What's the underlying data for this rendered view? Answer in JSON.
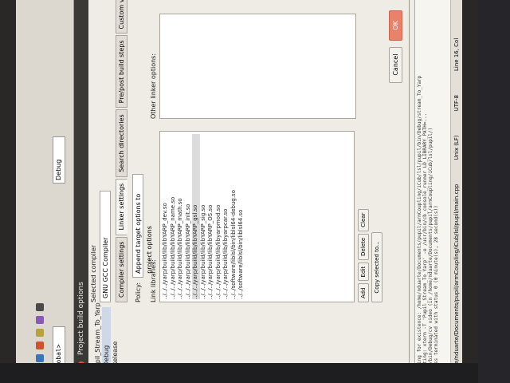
{
  "ide": {
    "global_scope": "<global>",
    "build_target": "Debug",
    "log_lines": [
      "Checking for existence: /home/nduarte/Documents/pupil/armCoupling/iCub/lsl/pupil/bin/Debug/stream_To_Yarp",
      "Executing: xterm -T 'Pupil_Stream_To_Yarp' -e /usr/bin/cb_console_runner LD_LIBRARY_PATH=...",
      "pupil/bin/Debug/cv video   (in /home/nduarte/Documents/pupil/armCoupling/iCub/lsl/pupil/)",
      "Process terminated with status 0 (0 minute(s), 28 second(s))"
    ],
    "status_path": "/home/nduarte/Documents/pupil/armCoupling/iCub/lsl/pupil/main.cpp",
    "status_eol": "Unix (LF)",
    "status_encoding": "UTF-8",
    "status_position": "Line 16, Col"
  },
  "dialog": {
    "title": "Project build options",
    "tree": [
      "Pupil_Stream_To_Yarp",
      "Debug",
      "Release"
    ],
    "selected_compiler_label": "Selected compiler",
    "compiler": "GNU GCC Compiler",
    "tabs": [
      "Compiler settings",
      "Linker settings",
      "Search directories",
      "Pre/post build steps",
      "Custom variable"
    ],
    "policy_label": "Policy:",
    "policy_value": "Append target options to project options",
    "link_libraries_label": "Link libraries:",
    "other_linker_label": "Other linker options:",
    "libraries": [
      "../../../yarp/build/lib/libYARP_dev.so",
      "../../../yarp/build/lib/libYARP_name.so",
      "../../../yarp/build/lib/libYARP_math.so",
      "../../../yarp/build/lib/libYARP_init.so",
      "../../../yarp/build/lib/libYARP_gsl.so",
      "../../../yarp/build/lib/libYARP_sig.so",
      "../../../yarp/build/lib/libYARP_OS.so",
      "../../../yarp/build/lib/libyarpmod.so",
      "../../../yarp/build/lib/libyarpcar.so",
      "../../software/liblsl/bin/liblsl64-debug.so",
      "../../software/liblsl/bin/liblsl64.so"
    ],
    "buttons": {
      "add": "Add",
      "edit": "Edit",
      "delete": "Delete",
      "clear": "Clear",
      "copy": "Copy selected to..."
    },
    "ok": "OK",
    "cancel": "Cancel"
  }
}
